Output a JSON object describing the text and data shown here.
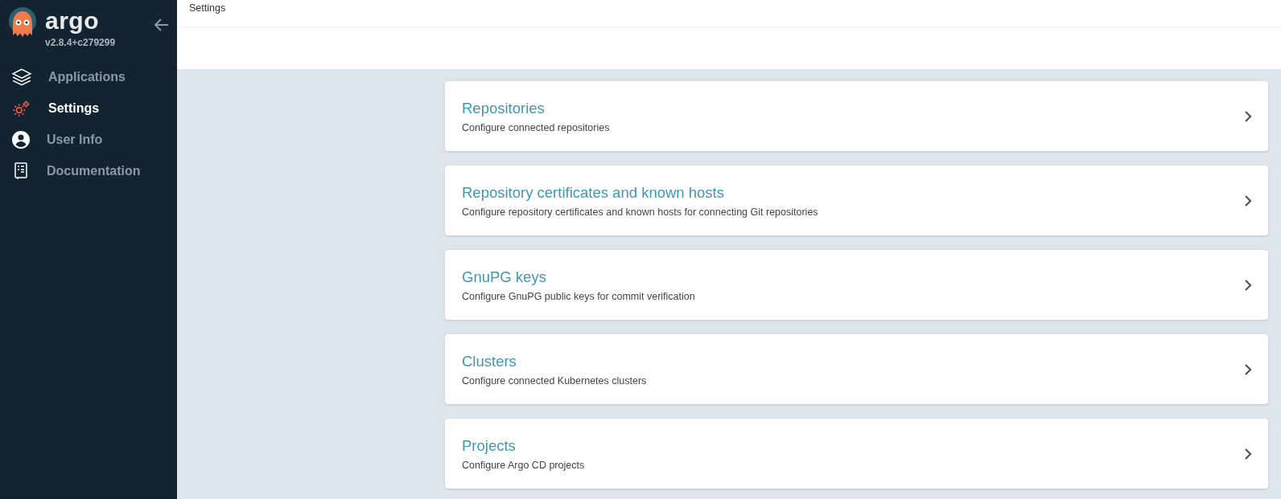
{
  "sidebar": {
    "logo": "argo",
    "version": "v2.8.4+c279299",
    "items": [
      {
        "label": "Applications",
        "selected": false
      },
      {
        "label": "Settings",
        "selected": true
      },
      {
        "label": "User Info",
        "selected": false
      },
      {
        "label": "Documentation",
        "selected": false
      }
    ]
  },
  "header": {
    "breadcrumb": "Settings"
  },
  "cards": [
    {
      "title": "Repositories",
      "description": "Configure connected repositories"
    },
    {
      "title": "Repository certificates and known hosts",
      "description": "Configure repository certificates and known hosts for connecting Git repositories"
    },
    {
      "title": "GnuPG keys",
      "description": "Configure GnuPG public keys for commit verification"
    },
    {
      "title": "Clusters",
      "description": "Configure connected Kubernetes clusters"
    },
    {
      "title": "Projects",
      "description": "Configure Argo CD projects"
    }
  ]
}
